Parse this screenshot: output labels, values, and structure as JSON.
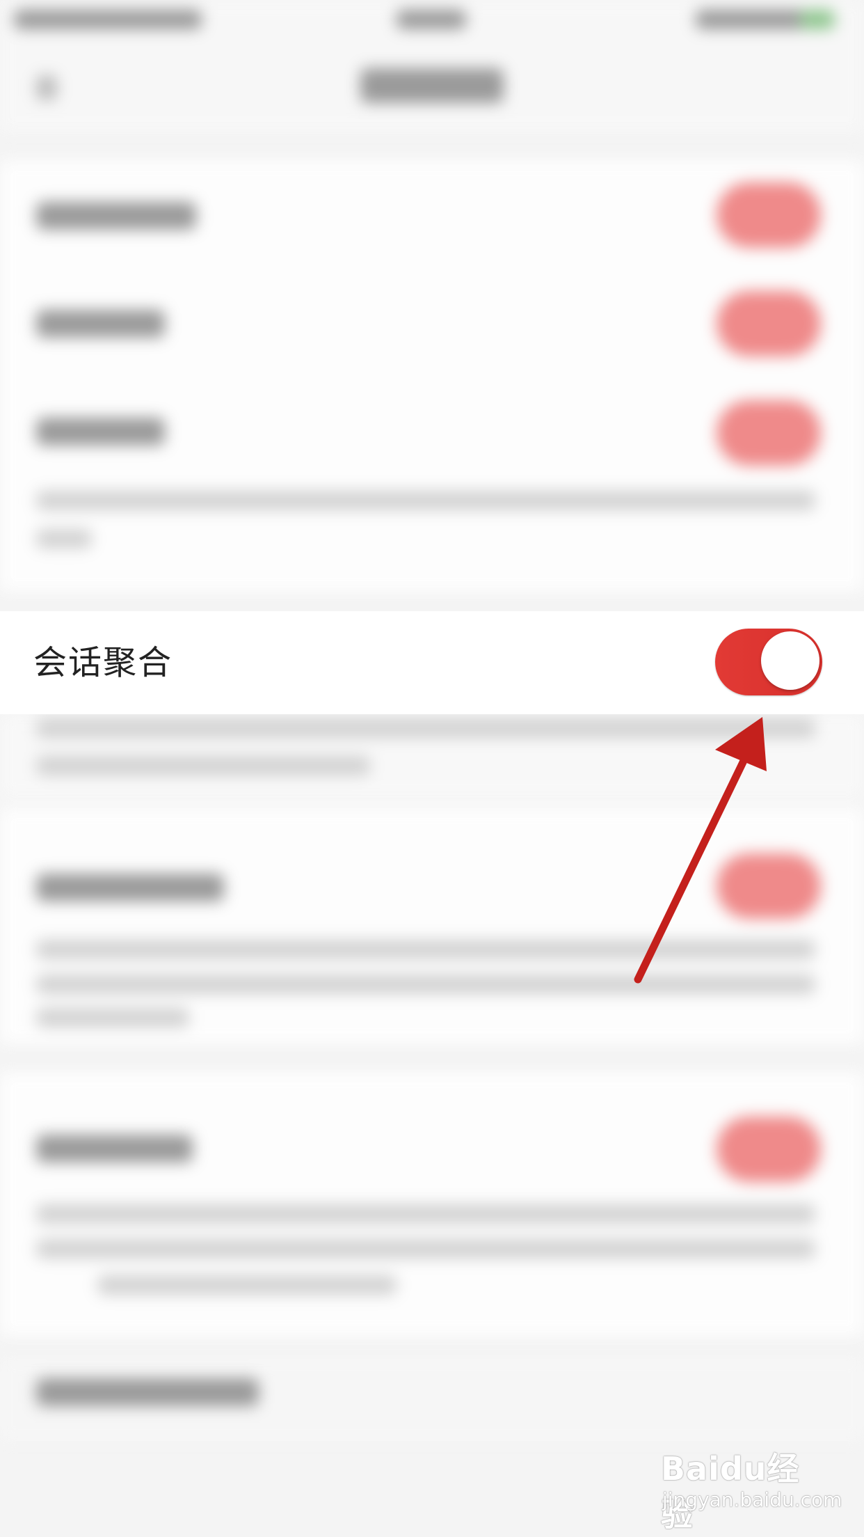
{
  "setting": {
    "label": "会话聚合",
    "enabled": true
  },
  "colors": {
    "accent": "#e23a35",
    "arrow": "#c4201c",
    "background": "#f4f4f4"
  },
  "watermark": {
    "brand": "Baidu经验",
    "url": "jingyan.baidu.com"
  }
}
